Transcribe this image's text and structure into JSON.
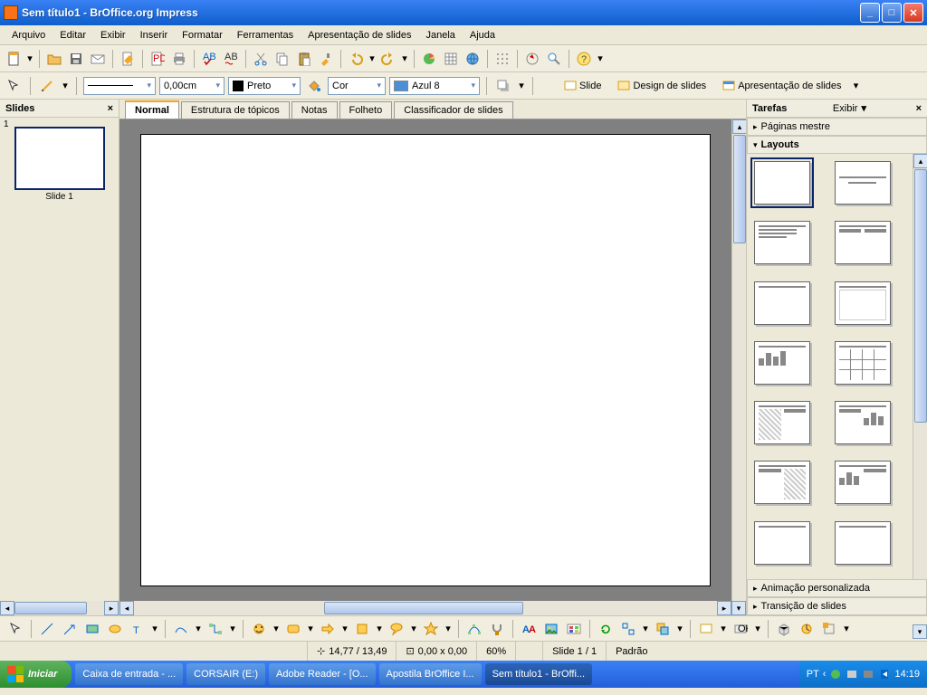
{
  "window": {
    "title": "Sem título1 - BrOffice.org Impress"
  },
  "menu": [
    "Arquivo",
    "Editar",
    "Exibir",
    "Inserir",
    "Formatar",
    "Ferramentas",
    "Apresentação de slides",
    "Janela",
    "Ajuda"
  ],
  "formatbar": {
    "line_width": "0,00cm",
    "line_color_label": "Preto",
    "fill_type": "Cor",
    "fill_color_label": "Azul 8"
  },
  "presentation_buttons": {
    "slide": "Slide",
    "design": "Design de slides",
    "show": "Apresentação de slides"
  },
  "slides_panel": {
    "title": "Slides",
    "slide_label": "Slide 1",
    "slide_number": "1"
  },
  "view_tabs": [
    "Normal",
    "Estrutura de tópicos",
    "Notas",
    "Folheto",
    "Classificador de slides"
  ],
  "tasks_panel": {
    "title": "Tarefas",
    "view_label": "Exibir",
    "sections": {
      "master": "Páginas mestre",
      "layouts": "Layouts",
      "anim": "Animação personalizada",
      "trans": "Transição de slides"
    }
  },
  "status": {
    "pos": "14,77 / 13,49",
    "size": "0,00 x 0,00",
    "zoom": "60%",
    "slide": "Slide 1 / 1",
    "template": "Padrão"
  },
  "taskbar": {
    "start": "Iniciar",
    "items": [
      "Caixa de entrada - ...",
      "CORSAIR (E:)",
      "Adobe Reader - [O...",
      "Apostila BrOffice I...",
      "Sem título1 - BrOffi..."
    ],
    "lang": "PT",
    "clock": "14:19"
  }
}
